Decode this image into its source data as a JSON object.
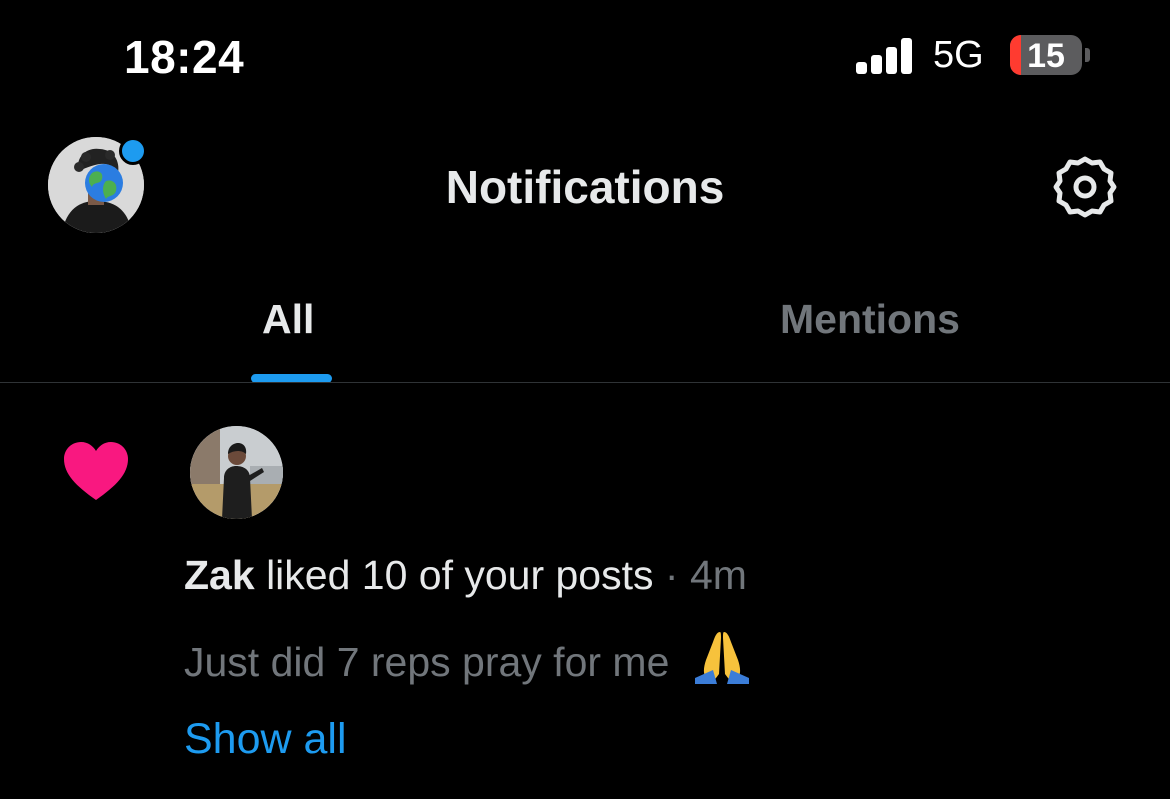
{
  "status_bar": {
    "time": "18:24",
    "network": "5G",
    "battery_level": "15",
    "battery_fraction": 0.15,
    "signal_bars": 4
  },
  "header": {
    "title": "Notifications",
    "unread_indicator_color": "#1d9bf0",
    "settings_icon": "gear-icon"
  },
  "tabs": [
    {
      "label": "All",
      "active": true
    },
    {
      "label": "Mentions",
      "active": false
    }
  ],
  "notifications": [
    {
      "icon": "heart-icon",
      "icon_color": "#f91880",
      "user": "Zak",
      "action": "liked 10 of your posts",
      "separator": "·",
      "time": "4m",
      "post_text": "Just did 7 reps pray for me",
      "emoji": "folded-hands",
      "show_all_label": "Show all"
    }
  ],
  "colors": {
    "background": "#000000",
    "accent": "#1d9bf0",
    "secondary_text": "#71767b",
    "primary_text": "#e7e9ea"
  }
}
